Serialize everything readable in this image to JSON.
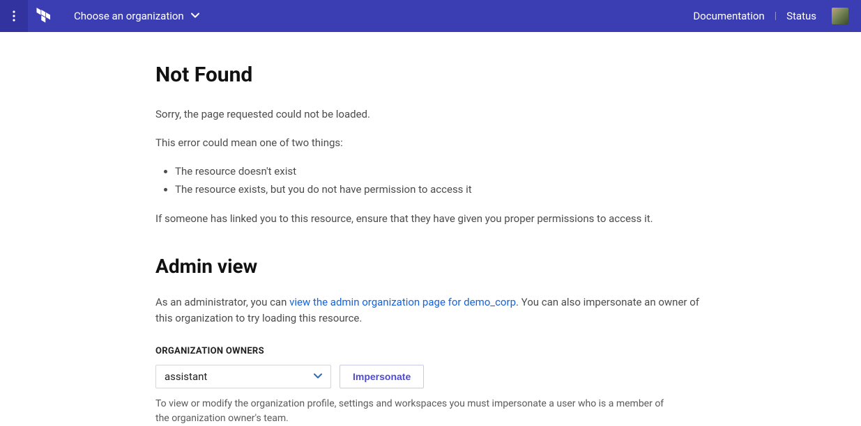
{
  "topbar": {
    "org_picker_label": "Choose an organization",
    "nav": {
      "documentation": "Documentation",
      "status": "Status"
    }
  },
  "page": {
    "title": "Not Found",
    "sorry": "Sorry, the page requested could not be loaded.",
    "error_intro": "This error could mean one of two things:",
    "reasons": [
      "The resource doesn't exist",
      "The resource exists, but you do not have permission to access it"
    ],
    "linked_hint": "If someone has linked you to this resource, ensure that they have given you proper permissions to access it."
  },
  "admin": {
    "title": "Admin view",
    "para_prefix": "As an administrator, you can ",
    "link_text": "view the admin organization page for demo_corp",
    "para_suffix": ". You can also impersonate an owner of this organization to try loading this resource.",
    "owners_label": "ORGANIZATION OWNERS",
    "selected_owner": "assistant",
    "impersonate_label": "Impersonate",
    "help_text": "To view or modify the organization profile, settings and workspaces you must impersonate a user who is a member of the organization owner's team."
  }
}
